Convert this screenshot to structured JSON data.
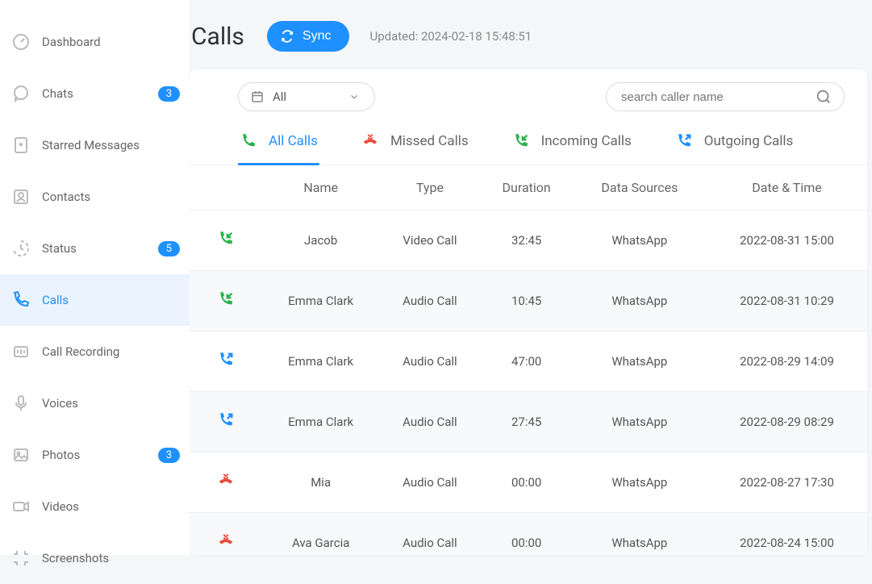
{
  "sidebar": {
    "items": [
      {
        "label": "Dashboard",
        "badge": null
      },
      {
        "label": "Chats",
        "badge": "3"
      },
      {
        "label": "Starred Messages",
        "badge": null
      },
      {
        "label": "Contacts",
        "badge": null
      },
      {
        "label": "Status",
        "badge": "5"
      },
      {
        "label": "Calls",
        "badge": null
      },
      {
        "label": "Call Recording",
        "badge": null
      },
      {
        "label": "Voices",
        "badge": null
      },
      {
        "label": "Photos",
        "badge": "3"
      },
      {
        "label": "Videos",
        "badge": null
      },
      {
        "label": "Screenshots",
        "badge": null
      }
    ],
    "active_index": 5
  },
  "header": {
    "title": "Calls",
    "sync_label": "Sync",
    "updated_label": "Updated: 2024-02-18 15:48:51"
  },
  "controls": {
    "dropdown_value": "All",
    "search_placeholder": "search caller name"
  },
  "tabs": [
    {
      "label": "All Calls"
    },
    {
      "label": "Missed Calls"
    },
    {
      "label": "Incoming Calls"
    },
    {
      "label": "Outgoing Calls"
    }
  ],
  "tabs_active_index": 0,
  "columns": {
    "name": "Name",
    "type": "Type",
    "duration": "Duration",
    "source": "Data Sources",
    "datetime": "Date & Time"
  },
  "rows": [
    {
      "icon": "incoming",
      "name": "Jacob",
      "type": "Video Call",
      "duration": "32:45",
      "source": "WhatsApp",
      "datetime": "2022-08-31 15:00"
    },
    {
      "icon": "incoming",
      "name": "Emma Clark",
      "type": "Audio Call",
      "duration": "10:45",
      "source": "WhatsApp",
      "datetime": "2022-08-31 10:29"
    },
    {
      "icon": "outgoing",
      "name": "Emma Clark",
      "type": "Audio Call",
      "duration": "47:00",
      "source": "WhatsApp",
      "datetime": "2022-08-29 14:09"
    },
    {
      "icon": "outgoing",
      "name": "Emma Clark",
      "type": "Audio Call",
      "duration": "27:45",
      "source": "WhatsApp",
      "datetime": "2022-08-29 08:29"
    },
    {
      "icon": "missed",
      "name": "Mia",
      "type": "Audio Call",
      "duration": "00:00",
      "source": "WhatsApp",
      "datetime": "2022-08-27 17:30"
    },
    {
      "icon": "missed",
      "name": "Ava Garcia",
      "type": "Audio Call",
      "duration": "00:00",
      "source": "WhatsApp",
      "datetime": "2022-08-24 15:00"
    }
  ]
}
